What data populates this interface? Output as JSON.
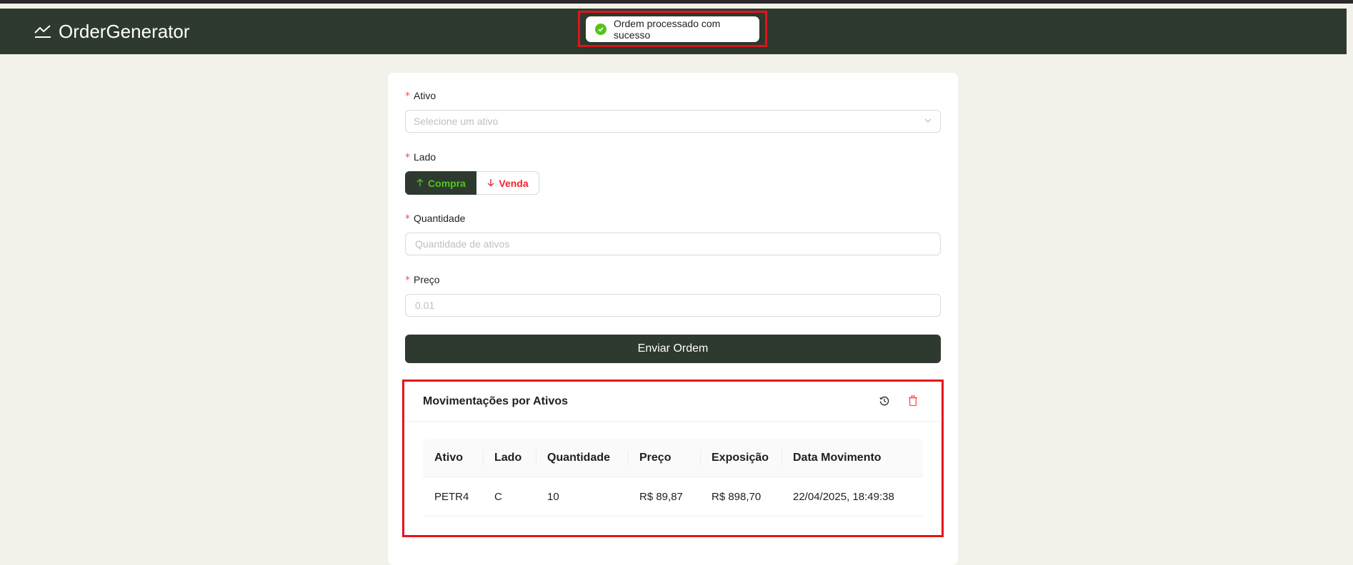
{
  "header": {
    "brand": "OrderGenerator",
    "brand_icon": "line-chart-icon"
  },
  "toast": {
    "message": "Ordem processado com sucesso",
    "icon": "check-circle-icon",
    "color": "#52c41a"
  },
  "form": {
    "ativo": {
      "label": "Ativo",
      "placeholder": "Selecione um ativo",
      "value": ""
    },
    "lado": {
      "label": "Lado",
      "options": [
        {
          "label": "Compra",
          "icon": "arrow-up-icon",
          "selected": true
        },
        {
          "label": "Venda",
          "icon": "arrow-down-icon",
          "selected": false
        }
      ]
    },
    "quantidade": {
      "label": "Quantidade",
      "placeholder": "Quantidade de ativos",
      "value": ""
    },
    "preco": {
      "label": "Preço",
      "placeholder": "0.01",
      "value": ""
    },
    "submit_label": "Enviar Ordem"
  },
  "movimentacoes": {
    "title": "Movimentações por Ativos",
    "actions": [
      "history-icon",
      "delete-icon"
    ],
    "columns": [
      "Ativo",
      "Lado",
      "Quantidade",
      "Preço",
      "Exposição",
      "Data Movimento"
    ],
    "rows": [
      [
        "PETR4",
        "C",
        "10",
        "R$ 89,87",
        "R$ 898,70",
        "22/04/2025, 18:49:38"
      ]
    ]
  },
  "colors": {
    "header_bg": "#2e3a2f",
    "page_bg": "#f2f2ea",
    "buy": "#52c41a",
    "sell": "#f5222d",
    "highlight": "#e5141b"
  }
}
